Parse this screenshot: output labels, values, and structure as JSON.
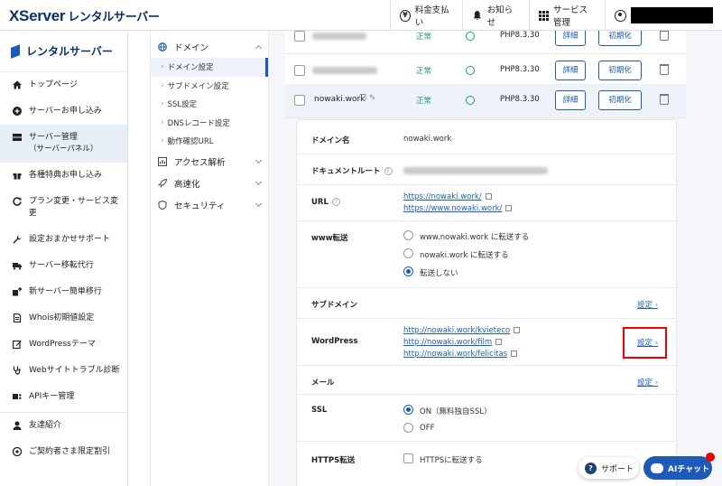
{
  "header": {
    "logo_main": "XServer",
    "logo_sub": "レンタルサーバー",
    "nav": [
      "料金支払い",
      "お知らせ",
      "サービス管理"
    ]
  },
  "sidebar": {
    "title": "レンタルサーバー",
    "items": [
      {
        "label": "トップページ",
        "sub": ""
      },
      {
        "label": "サーバーお申し込み",
        "sub": ""
      },
      {
        "label": "サーバー管理",
        "sub": "（サーバーパネル）"
      },
      {
        "label": "各種特典お申し込み",
        "sub": ""
      },
      {
        "label": "プラン変更・サービス変",
        "sub": "更"
      },
      {
        "label": "設定おまかせサポート",
        "sub": ""
      },
      {
        "label": "サーバー移転代行",
        "sub": ""
      },
      {
        "label": "新サーバー簡単移行",
        "sub": ""
      },
      {
        "label": "Whois初期値設定",
        "sub": ""
      },
      {
        "label": "WordPressテーマ",
        "sub": ""
      },
      {
        "label": "Webサイトトラブル診断",
        "sub": ""
      },
      {
        "label": "APIキー管理",
        "sub": ""
      },
      {
        "label": "友達紹介",
        "sub": ""
      },
      {
        "label": "ご契約者さま限定割引",
        "sub": ""
      }
    ]
  },
  "subnav": {
    "domain": "ドメイン",
    "items": [
      "ドメイン設定",
      "サブドメイン設定",
      "SSL設定",
      "DNSレコード設定",
      "動作確認URL"
    ],
    "access": "アクセス解析",
    "speed": "高速化",
    "security": "セキュリティ"
  },
  "domains": {
    "status": "正常",
    "php": "PHP8.3.30",
    "detail": "詳細",
    "init": "初期化",
    "selected": "nowaki.work"
  },
  "detail": {
    "domain_label": "ドメイン名",
    "domain_value": "nowaki.work",
    "docroot_label": "ドキュメントルート",
    "url_label": "URL",
    "urls": [
      "https://nowaki.work/",
      "https://www.nowaki.work/"
    ],
    "www_label": "www転送",
    "www_options": [
      "www.nowaki.work に転送する",
      "nowaki.work に転送する",
      "転送しない"
    ],
    "sub_label": "サブドメイン",
    "wp_label": "WordPress",
    "wp_links": [
      "http://nowaki.work/kvieteco",
      "http://nowaki.work/film",
      "http://nowaki.work/felicitas"
    ],
    "mail_label": "メール",
    "ssl_label": "SSL",
    "ssl_options": [
      "ON（無料独自SSL）",
      "OFF"
    ],
    "https_label": "HTTPS転送",
    "https_option": "HTTPSに転送する",
    "set": "設定"
  },
  "floating": {
    "support": "サポート",
    "ai": "AIチャット"
  }
}
